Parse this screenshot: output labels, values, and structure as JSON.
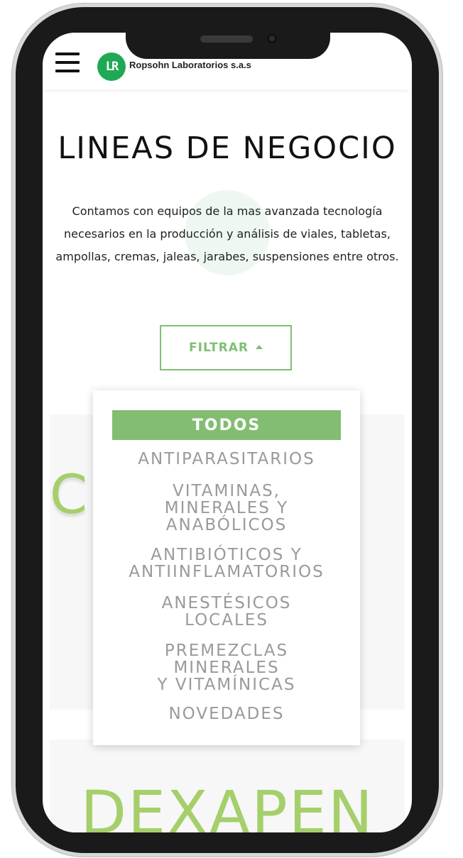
{
  "header": {
    "logo_text": "LR",
    "brand_name": "Ropsohn Laboratorios s.a.s"
  },
  "page": {
    "title": "LINEAS DE NEGOCIO",
    "description": "Contamos con equipos de la mas avanzada tecnología necesarios en la producción y análisis de viales, tabletas, ampollas, cremas, jaleas, jarabes, suspensiones entre otros.",
    "filter_label": "FILTRAR"
  },
  "filter_menu": {
    "active": "TODOS",
    "items": [
      {
        "lines": [
          "ANTIPARASITARIOS"
        ]
      },
      {
        "lines": [
          "VITAMINAS,",
          "MINERALES Y",
          "ANABÓLICOS"
        ]
      },
      {
        "lines": [
          "ANTIBIÓTICOS Y",
          "ANTIINFLAMATORIOS"
        ]
      },
      {
        "lines": [
          "ANESTÉSICOS",
          "LOCALES"
        ]
      },
      {
        "lines": [
          "PREMEZCLAS",
          "MINERALES",
          "Y VITAMÍNICAS"
        ]
      },
      {
        "lines": [
          "NOVEDADES"
        ]
      }
    ]
  },
  "products": {
    "first_visible_partial": "C                N",
    "second": "DEXAPEN"
  },
  "colors": {
    "accent_green": "#82bd72",
    "logo_green": "#1fa955",
    "product_green": "#a5cf6b",
    "menu_text": "#9a9a9a"
  }
}
